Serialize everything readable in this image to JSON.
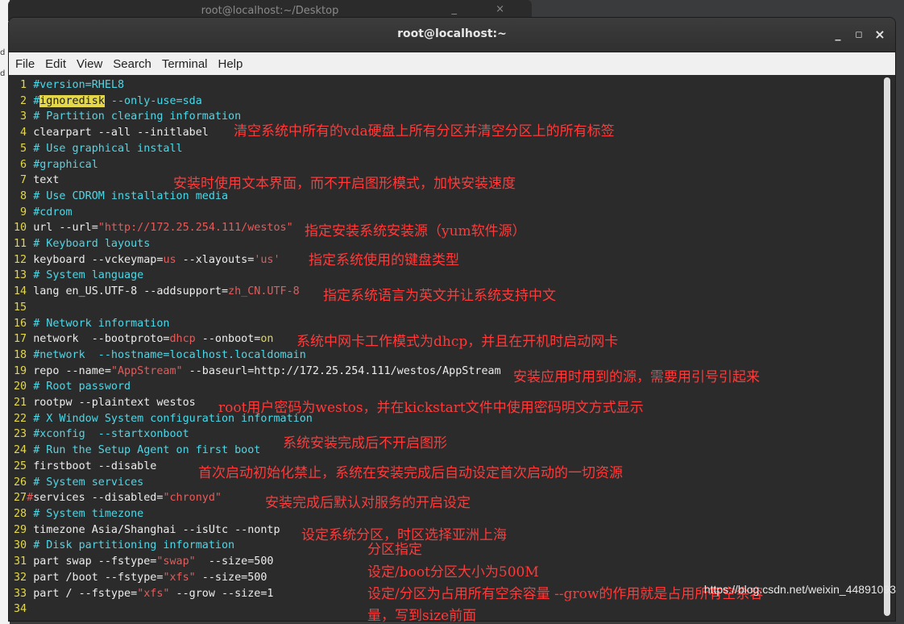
{
  "background_window": {
    "title": "root@localhost:~/Desktop",
    "controls": "_ ×"
  },
  "window": {
    "title": "root@localhost:~",
    "controls": {
      "minimize": "_",
      "maximize": "◻",
      "close": "×"
    }
  },
  "menu": [
    "File",
    "Edit",
    "View",
    "Search",
    "Terminal",
    "Help"
  ],
  "lines": [
    {
      "n": "1",
      "p": [
        {
          "c": "cm",
          "t": "#version=RHEL8"
        }
      ]
    },
    {
      "n": "2",
      "p": [
        {
          "c": "cm",
          "t": "#"
        },
        {
          "c": "hl",
          "t": "ignoredisk"
        },
        {
          "c": "cm",
          "t": " --only-use=sda"
        }
      ]
    },
    {
      "n": "3",
      "p": [
        {
          "c": "cm",
          "t": "# Partition clearing information"
        }
      ]
    },
    {
      "n": "4",
      "p": [
        {
          "c": "",
          "t": "clearpart --all --initlabel"
        }
      ]
    },
    {
      "n": "5",
      "p": [
        {
          "c": "cm",
          "t": "# Use graphical install"
        }
      ]
    },
    {
      "n": "6",
      "p": [
        {
          "c": "cm",
          "t": "#graphical"
        }
      ]
    },
    {
      "n": "7",
      "p": [
        {
          "c": "",
          "t": "text"
        }
      ]
    },
    {
      "n": "8",
      "p": [
        {
          "c": "cm",
          "t": "# Use CDROM installation media"
        }
      ]
    },
    {
      "n": "9",
      "p": [
        {
          "c": "cm",
          "t": "#cdrom"
        }
      ]
    },
    {
      "n": "10",
      "p": [
        {
          "c": "",
          "t": "url --url="
        },
        {
          "c": "st",
          "t": "\"http://172.25.254.111/westos\""
        }
      ]
    },
    {
      "n": "11",
      "p": [
        {
          "c": "cm",
          "t": "# Keyboard layouts"
        }
      ]
    },
    {
      "n": "12",
      "p": [
        {
          "c": "",
          "t": "keyboard --vckeymap="
        },
        {
          "c": "st",
          "t": "us"
        },
        {
          "c": "",
          "t": " --xlayouts="
        },
        {
          "c": "st",
          "t": "'us'"
        }
      ]
    },
    {
      "n": "13",
      "p": [
        {
          "c": "cm",
          "t": "# System language"
        }
      ]
    },
    {
      "n": "14",
      "p": [
        {
          "c": "",
          "t": "lang en_US.UTF-8 --addsupport="
        },
        {
          "c": "st",
          "t": "zh_CN.UTF-8"
        }
      ]
    },
    {
      "n": "15",
      "p": []
    },
    {
      "n": "16",
      "p": [
        {
          "c": "cm",
          "t": "# Network information"
        }
      ]
    },
    {
      "n": "17",
      "p": [
        {
          "c": "",
          "t": "network  --bootproto="
        },
        {
          "c": "st",
          "t": "dhcp"
        },
        {
          "c": "",
          "t": " --onboot="
        },
        {
          "c": "kw",
          "t": "on"
        }
      ]
    },
    {
      "n": "18",
      "p": [
        {
          "c": "cm",
          "t": "#network  --hostname=localhost.localdomain"
        }
      ]
    },
    {
      "n": "19",
      "p": [
        {
          "c": "",
          "t": "repo --name="
        },
        {
          "c": "st",
          "t": "\"AppStream\""
        },
        {
          "c": "",
          "t": " --baseurl=http://172.25.254.111/westos/AppStream"
        }
      ]
    },
    {
      "n": "20",
      "p": [
        {
          "c": "cm",
          "t": "# Root password"
        }
      ]
    },
    {
      "n": "21",
      "p": [
        {
          "c": "",
          "t": "rootpw --plaintext westos"
        }
      ]
    },
    {
      "n": "22",
      "p": [
        {
          "c": "cm",
          "t": "# X Window System configuration information"
        }
      ]
    },
    {
      "n": "23",
      "p": [
        {
          "c": "cm",
          "t": "#xconfig  --startxonboot"
        }
      ]
    },
    {
      "n": "24",
      "p": [
        {
          "c": "cm",
          "t": "# Run the Setup Agent on first boot"
        }
      ]
    },
    {
      "n": "25",
      "p": [
        {
          "c": "",
          "t": "firstboot --disable"
        }
      ]
    },
    {
      "n": "26",
      "p": [
        {
          "c": "cm",
          "t": "# System services"
        }
      ]
    },
    {
      "n": "27",
      "p": [
        {
          "c": "st",
          "t": "#"
        },
        {
          "c": "",
          "t": "services --disabled="
        },
        {
          "c": "st",
          "t": "\"chronyd\""
        }
      ]
    },
    {
      "n": "28",
      "p": [
        {
          "c": "cm",
          "t": "# System timezone"
        }
      ]
    },
    {
      "n": "29",
      "p": [
        {
          "c": "",
          "t": "timezone Asia/Shanghai --isUtc --nontp"
        }
      ]
    },
    {
      "n": "30",
      "p": [
        {
          "c": "cm",
          "t": "# Disk partitioning information"
        }
      ]
    },
    {
      "n": "31",
      "p": [
        {
          "c": "",
          "t": "part swap --fstype="
        },
        {
          "c": "st",
          "t": "\"swap\""
        },
        {
          "c": "",
          "t": "  --size=500"
        }
      ]
    },
    {
      "n": "32",
      "p": [
        {
          "c": "",
          "t": "part /boot --fstype="
        },
        {
          "c": "st",
          "t": "\"xfs\""
        },
        {
          "c": "",
          "t": " --size=500"
        }
      ]
    },
    {
      "n": "33",
      "p": [
        {
          "c": "",
          "t": "part / --fstype="
        },
        {
          "c": "st",
          "t": "\"xfs\""
        },
        {
          "c": "",
          "t": " --grow --size=1"
        }
      ]
    },
    {
      "n": "34",
      "p": []
    }
  ],
  "annotations": [
    "清空系统中所有的vda硬盘上所有分区并清空分区上的所有标签",
    "安装时使用文本界面，而不开启图形模式，加快安装速度",
    "指定安装系统安装源（yum软件源）",
    "指定系统使用的键盘类型",
    "指定系统语言为英文并让系统支持中文",
    "系统中网卡工作模式为dhcp，并且在开机时启动网卡",
    "安装应用时用到的源，需要用引号引起来",
    "root用户密码为westos，并在kickstart文件中使用密码明文方式显示",
    "系统安装完成后不开启图形",
    "首次启动初始化禁止，系统在安装完成后自动设定首次启动的一切资源",
    "安装完成后默认对服务的开启设定",
    "设定系统分区，时区选择亚洲上海",
    "分区指定",
    "设定/boot分区大小为500M",
    "设定/分区为占用所有空余容量  --grow的作用就是占用所有空余容",
    "量，写到size前面"
  ],
  "watermark": "https://blog.csdn.net/weixin_44891093",
  "colors": {
    "comment": "#4bd8e8",
    "string": "#e45b5b",
    "line_number": "#e4d84a",
    "annotation": "#ff3a3a"
  }
}
